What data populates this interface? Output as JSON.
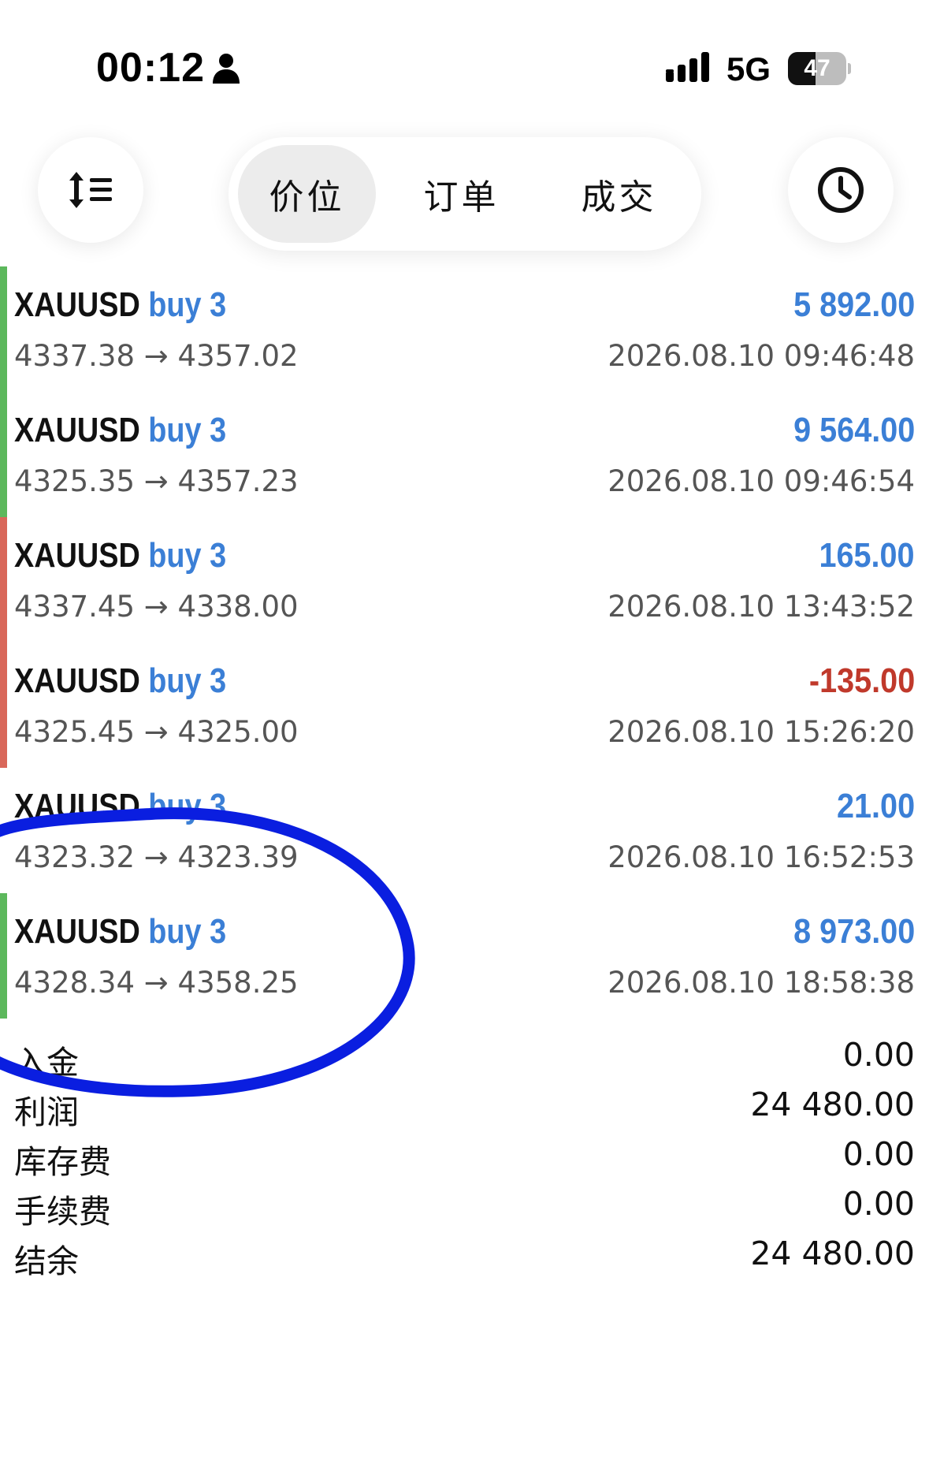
{
  "status_bar": {
    "time": "00:12",
    "network": "5G",
    "battery_level": "47",
    "battery_fraction": 0.47
  },
  "toolbar": {
    "sort_icon": "sort-arrows-list-icon",
    "history_icon": "clock-icon",
    "tabs": [
      {
        "label": "价位",
        "active": true
      },
      {
        "label": "订单",
        "active": false
      },
      {
        "label": "成交",
        "active": false
      }
    ]
  },
  "deals": [
    {
      "symbol": "XAUUSD",
      "side": "buy 3",
      "prices": "4337.38 → 4357.02",
      "profit": "5 892.00",
      "time": "2026.08.10 09:46:48",
      "result": "profit"
    },
    {
      "symbol": "XAUUSD",
      "side": "buy 3",
      "prices": "4325.35 → 4357.23",
      "profit": "9 564.00",
      "time": "2026.08.10 09:46:54",
      "result": "profit"
    },
    {
      "symbol": "XAUUSD",
      "side": "buy 3",
      "prices": "4337.45 → 4338.00",
      "profit": "165.00",
      "time": "2026.08.10 13:43:52",
      "result": "loss-bar"
    },
    {
      "symbol": "XAUUSD",
      "side": "buy 3",
      "prices": "4325.45 → 4325.00",
      "profit": "-135.00",
      "time": "2026.08.10 15:26:20",
      "result": "loss"
    },
    {
      "symbol": "XAUUSD",
      "side": "buy 3",
      "prices": "4323.32 → 4323.39",
      "profit": "21.00",
      "time": "2026.08.10 16:52:53",
      "result": "none"
    },
    {
      "symbol": "XAUUSD",
      "side": "buy 3",
      "prices": "4328.34 → 4358.25",
      "profit": "8 973.00",
      "time": "2026.08.10 18:58:38",
      "result": "profit"
    }
  ],
  "summary": [
    {
      "label": "入金",
      "value": "0.00"
    },
    {
      "label": "利润",
      "value": "24 480.00"
    },
    {
      "label": "库存费",
      "value": "0.00"
    },
    {
      "label": "手续费",
      "value": "0.00"
    },
    {
      "label": "结余",
      "value": "24 480.00"
    }
  ],
  "colors": {
    "profit_blue": "#3b7fd6",
    "loss_red": "#c0392b",
    "bar_green": "#5cb85c",
    "bar_red": "#d9675a",
    "annotation_blue": "#0a1ee0"
  }
}
